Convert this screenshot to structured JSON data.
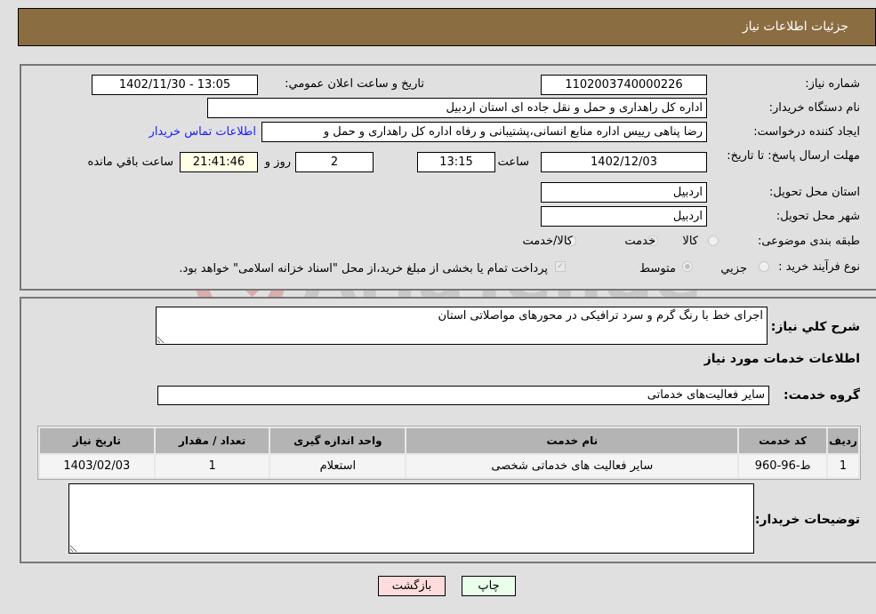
{
  "header": {
    "title": "جزئیات اطلاعات نیاز"
  },
  "form": {
    "need_number": {
      "label": "شماره نیاز:",
      "value": "1102003740000226"
    },
    "announce_datetime": {
      "label": "تاریخ و ساعت اعلان عمومي:",
      "value": "1402/11/30 - 13:05"
    },
    "buyer_org": {
      "label": "نام دستگاه خريدار:",
      "value": "اداره کل راهداری و حمل و نقل جاده ای استان اردبیل"
    },
    "requester": {
      "label": "ايجاد کننده درخواست:",
      "value": "رضا پناهی رییس اداره منابع انسانی،پشتیبانی و رفاه اداره کل راهداری و حمل و"
    },
    "contact_link": "اطلاعات تماس خريدار",
    "deadline": {
      "label": "مهلت ارسال پاسخ: تا تاريخ:",
      "date": "1402/12/03",
      "time_label": "ساعت",
      "time": "13:15",
      "days": "2",
      "days_label": "روز و",
      "remaining": "21:41:46",
      "remaining_label": "ساعت باقي مانده"
    },
    "province": {
      "label": "استان محل تحويل:",
      "value": "اردبیل"
    },
    "city": {
      "label": "شهر محل تحويل:",
      "value": "اردبیل"
    },
    "category": {
      "label": "طبقه بندی موضوعی:",
      "options": [
        "کالا",
        "خدمت",
        "کالا/خدمت"
      ],
      "selected": "خدمت"
    },
    "purchase_type": {
      "label": "نوع فرآيند خريد :",
      "options": [
        "جزيي",
        "متوسط"
      ],
      "selected": "متوسط",
      "treasury_note": "پرداخت تمام یا بخشی از مبلغ خرید،از محل \"اسناد خزانه اسلامی\" خواهد بود."
    }
  },
  "details": {
    "description_label": "شرح کلي نياز:",
    "description": "اجرای خط با رنگ گرم و سرد ترافیکی در محورهای مواصلاتی استان",
    "services_heading": "اطلاعات خدمات مورد نياز",
    "service_group_label": "گروه خدمت:",
    "service_group": "سایر فعالیت‌های خدماتی",
    "table": {
      "headers": [
        "رديف",
        "کد خدمت",
        "نام خدمت",
        "واحد اندازه گيری",
        "تعداد / مقدار",
        "تاريخ نياز"
      ],
      "rows": [
        [
          "1",
          "ط-96-960",
          "سایر فعالیت های خدماتی شخصی",
          "استعلام",
          "1",
          "1403/02/03"
        ]
      ]
    },
    "buyer_notes_label": "توضيحات خريدار:",
    "buyer_notes": ""
  },
  "buttons": {
    "print": "چاپ",
    "back": "بازگشت"
  },
  "colors": {
    "header_bg": "#8b6d42",
    "print_bg": "#eaffea",
    "back_bg": "#ffdcdc",
    "link": "#1a1aff"
  }
}
